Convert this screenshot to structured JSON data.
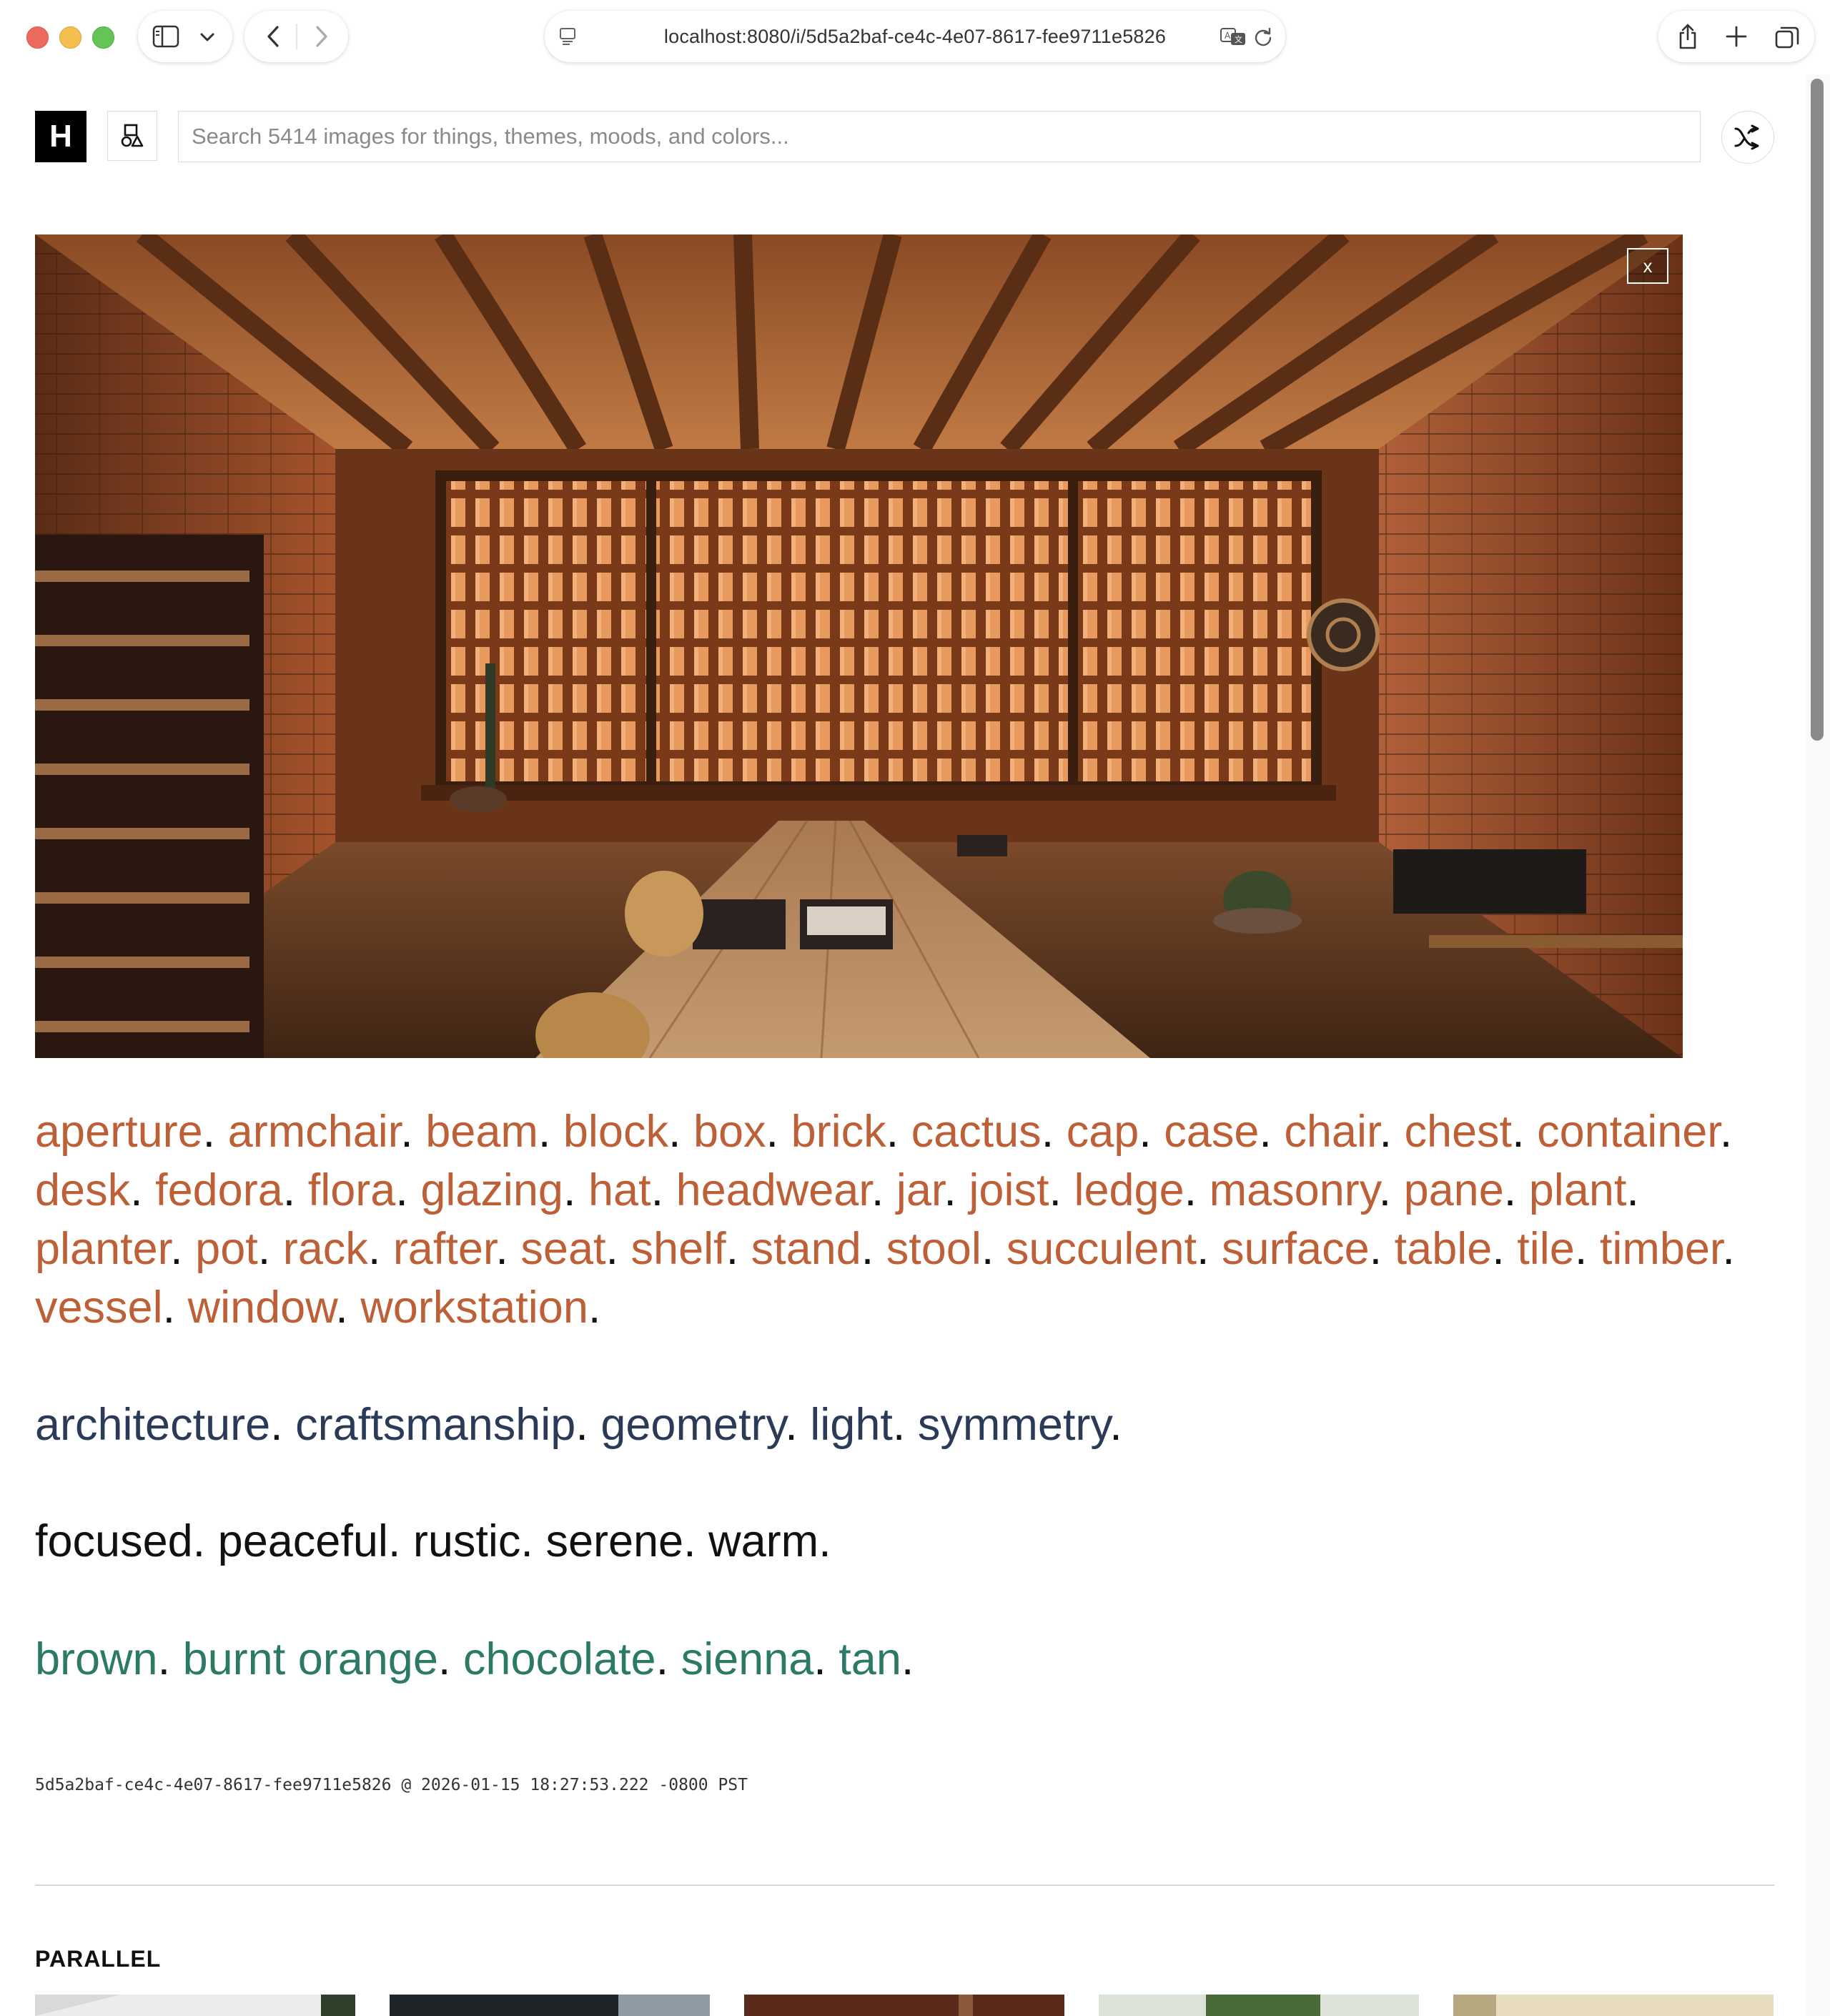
{
  "browser": {
    "url": "localhost:8080/i/5d5a2baf-ce4c-4e07-8617-fee9711e5826"
  },
  "header": {
    "logo_letter": "H",
    "search_placeholder": "Search 5414 images for things, themes, moods, and colors..."
  },
  "hero": {
    "close_label": "x"
  },
  "tags": {
    "objects": [
      "aperture",
      "armchair",
      "beam",
      "block",
      "box",
      "brick",
      "cactus",
      "cap",
      "case",
      "chair",
      "chest",
      "container",
      "desk",
      "fedora",
      "flora",
      "glazing",
      "hat",
      "headwear",
      "jar",
      "joist",
      "ledge",
      "masonry",
      "pane",
      "plant",
      "planter",
      "pot",
      "rack",
      "rafter",
      "seat",
      "shelf",
      "stand",
      "stool",
      "succulent",
      "surface",
      "table",
      "tile",
      "timber",
      "vessel",
      "window",
      "workstation"
    ],
    "themes": [
      "architecture",
      "craftsmanship",
      "geometry",
      "light",
      "symmetry"
    ],
    "moods": [
      "focused",
      "peaceful",
      "rustic",
      "serene",
      "warm"
    ],
    "colors": [
      "brown",
      "burnt orange",
      "chocolate",
      "sienna",
      "tan"
    ]
  },
  "meta": {
    "id_timestamp": "5d5a2baf-ce4c-4e07-8617-fee9711e5826 @ 2026-01-15 18:27:53.222 -0800 PST"
  },
  "parallel": {
    "title": "PARALLEL"
  },
  "colors": {
    "object_tag": "#bd5f37",
    "theme_tag": "#2a3a57",
    "mood_tag": "#111111",
    "color_tag": "#2c7a66"
  }
}
